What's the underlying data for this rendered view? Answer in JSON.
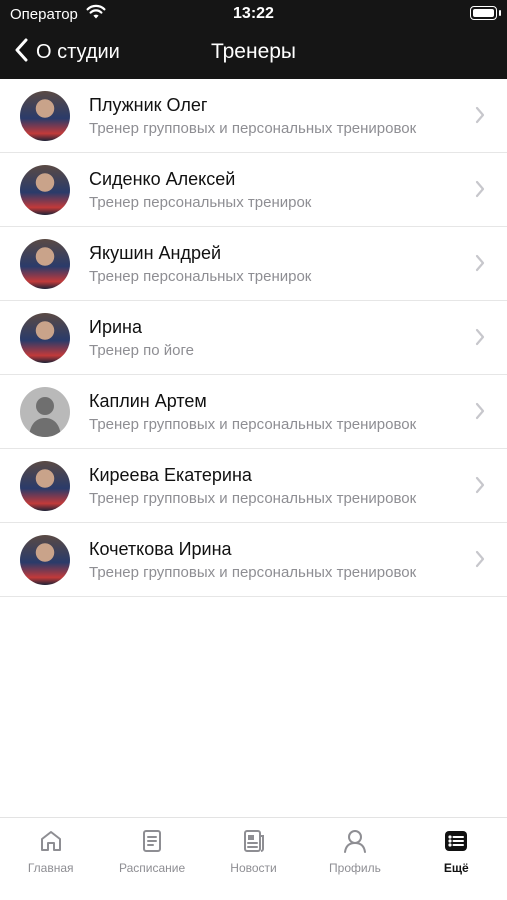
{
  "status_bar": {
    "carrier": "Оператор",
    "time": "13:22"
  },
  "nav": {
    "back_label": "О студии",
    "title": "Тренеры"
  },
  "trainers": [
    {
      "name": "Плужник Олег",
      "role": "Тренер групповых и персональных тренировок",
      "avatar": "photo"
    },
    {
      "name": "Сиденко Алексей",
      "role": "Тренер персональных тренирок",
      "avatar": "photo"
    },
    {
      "name": "Якушин Андрей",
      "role": "Тренер персональных тренирок",
      "avatar": "photo"
    },
    {
      "name": "Ирина",
      "role": "Тренер по йоге",
      "avatar": "photo"
    },
    {
      "name": "Каплин Артем",
      "role": "Тренер групповых и персональных тренировок",
      "avatar": "default-user-icon"
    },
    {
      "name": "Киреева Екатерина",
      "role": "Тренер групповых и персональных тренировок",
      "avatar": "photo"
    },
    {
      "name": "Кочеткова Ирина",
      "role": "Тренер групповых и персональных тренировок",
      "avatar": "photo"
    }
  ],
  "tabbar": {
    "items": [
      {
        "label": "Главная",
        "icon": "home-icon",
        "active": false
      },
      {
        "label": "Расписание",
        "icon": "schedule-icon",
        "active": false
      },
      {
        "label": "Новости",
        "icon": "news-icon",
        "active": false
      },
      {
        "label": "Профиль",
        "icon": "profile-icon",
        "active": false
      },
      {
        "label": "Ещё",
        "icon": "more-icon",
        "active": true
      }
    ]
  },
  "colors": {
    "header_bg": "#151515",
    "secondary_text": "#8e8e93",
    "chevron": "#c7c7cc"
  }
}
